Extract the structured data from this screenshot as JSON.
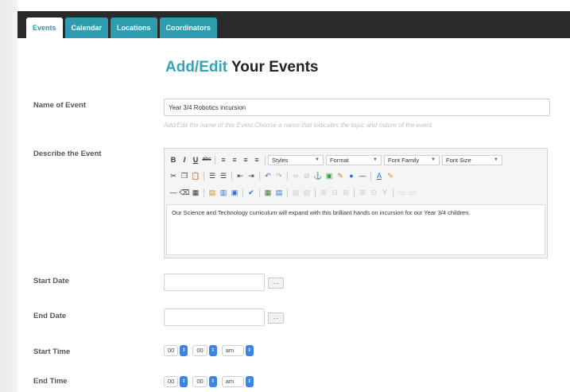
{
  "tabs": [
    "Events",
    "Calendar",
    "Locations",
    "Coordinators"
  ],
  "heading": {
    "accent": "Add/Edit",
    "rest": " Your Events"
  },
  "fields": {
    "name_label": "Name of Event",
    "name_value": "Year 3/4 Robotics incursion",
    "name_hint": "Add/Edit the name of this Event.Choose a name that indicates the topic and nature of the event.",
    "describe_label": "Describe the Event",
    "describe_value": "Our Science and Technology curriculum will expand with this brilliant hands on incursion for our Year 3/4 children.",
    "start_date_label": "Start Date",
    "end_date_label": "End Date",
    "start_time_label": "Start Time",
    "end_time_label": "End Time",
    "date_button": "..."
  },
  "editor": {
    "selects": [
      "Styles",
      "Format",
      "Font Family",
      "Font Size"
    ]
  },
  "time": {
    "hour": "00",
    "minute": "00",
    "ampm": "am"
  },
  "colors": {
    "accent": "#35a3b6",
    "tab": "#2e9bb0",
    "select_arrow": "#3b83e5",
    "topbar": "#2a2a2a"
  }
}
